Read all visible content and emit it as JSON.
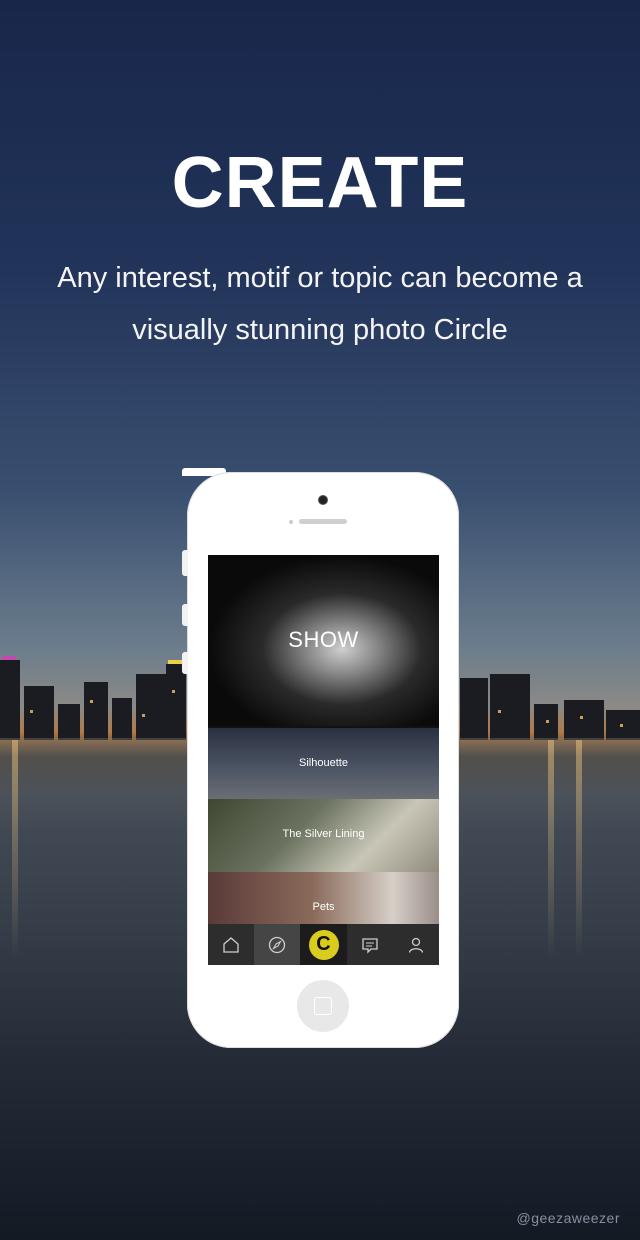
{
  "header": {
    "title": "CREATE",
    "subtitle": "Any interest, motif or topic can become a visually stunning photo Circle"
  },
  "phone": {
    "circles": [
      {
        "label": "SHOW"
      },
      {
        "label": "Silhouette"
      },
      {
        "label": "The Silver Lining"
      },
      {
        "label": "Pets"
      }
    ],
    "tabbar": {
      "items": [
        {
          "icon": "home-icon"
        },
        {
          "icon": "compass-icon"
        },
        {
          "icon": "circle-logo-icon",
          "text": "C"
        },
        {
          "icon": "message-icon"
        },
        {
          "icon": "profile-icon"
        }
      ],
      "accent": "#d9cc1e"
    }
  },
  "credit": "@geezaweezer"
}
